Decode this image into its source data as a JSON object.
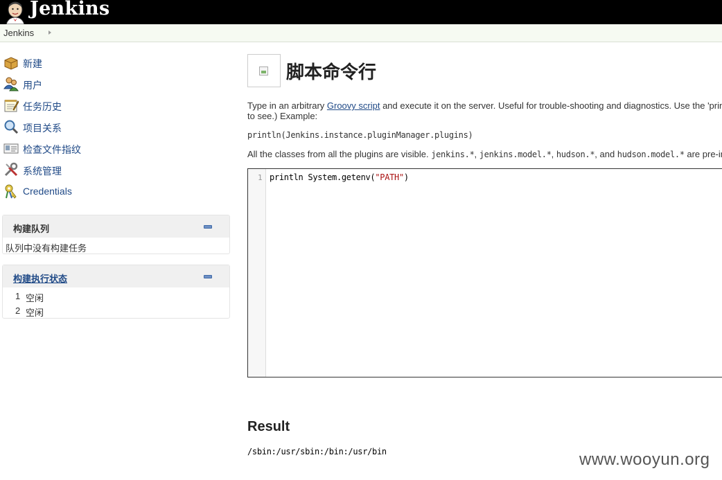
{
  "header": {
    "brand": "Jenkins"
  },
  "breadcrumb": {
    "items": [
      "Jenkins"
    ]
  },
  "sidebar": {
    "tasks": [
      {
        "label": "新建",
        "icon": "new-package-icon"
      },
      {
        "label": "用户",
        "icon": "users-icon"
      },
      {
        "label": "任务历史",
        "icon": "notepad-icon"
      },
      {
        "label": "项目关系",
        "icon": "magnifier-icon"
      },
      {
        "label": "检查文件指纹",
        "icon": "fingerprint-card-icon"
      },
      {
        "label": "系统管理",
        "icon": "tools-icon"
      },
      {
        "label": "Credentials",
        "icon": "keys-icon"
      }
    ],
    "build_queue": {
      "title": "构建队列",
      "empty_text": "队列中没有构建任务"
    },
    "executors": {
      "title": "构建执行状态",
      "rows": [
        {
          "num": "1",
          "status": "空闲"
        },
        {
          "num": "2",
          "status": "空闲"
        }
      ]
    }
  },
  "main": {
    "title": "脚本命令行",
    "intro_prefix": "Type in an arbitrary ",
    "intro_link": "Groovy script",
    "intro_suffix": " and execute it on the server. Useful for trouble-shooting and diagnostics. Use the 'prin",
    "intro_line2": "to see.) Example:",
    "example": "println(Jenkins.instance.pluginManager.plugins)",
    "classes_prefix": "All the classes from all the plugins are visible. ",
    "pkg1": "jenkins.*",
    "sep1": ", ",
    "pkg2": "jenkins.model.*",
    "sep2": ", ",
    "pkg3": "hudson.*",
    "sep3": ", and ",
    "pkg4": "hudson.model.*",
    "classes_suffix": " are pre-impo",
    "editor": {
      "line_number": "1",
      "code_plain": "println System.getenv(",
      "code_string": "\"PATH\"",
      "code_close": ")"
    },
    "result_heading": "Result",
    "result_output": "/sbin:/usr/sbin:/bin:/usr/bin"
  },
  "watermark": "www.wooyun.org",
  "colors": {
    "header_bg": "#000000",
    "link": "#204a87",
    "pane_header": "#f0f0f0"
  }
}
